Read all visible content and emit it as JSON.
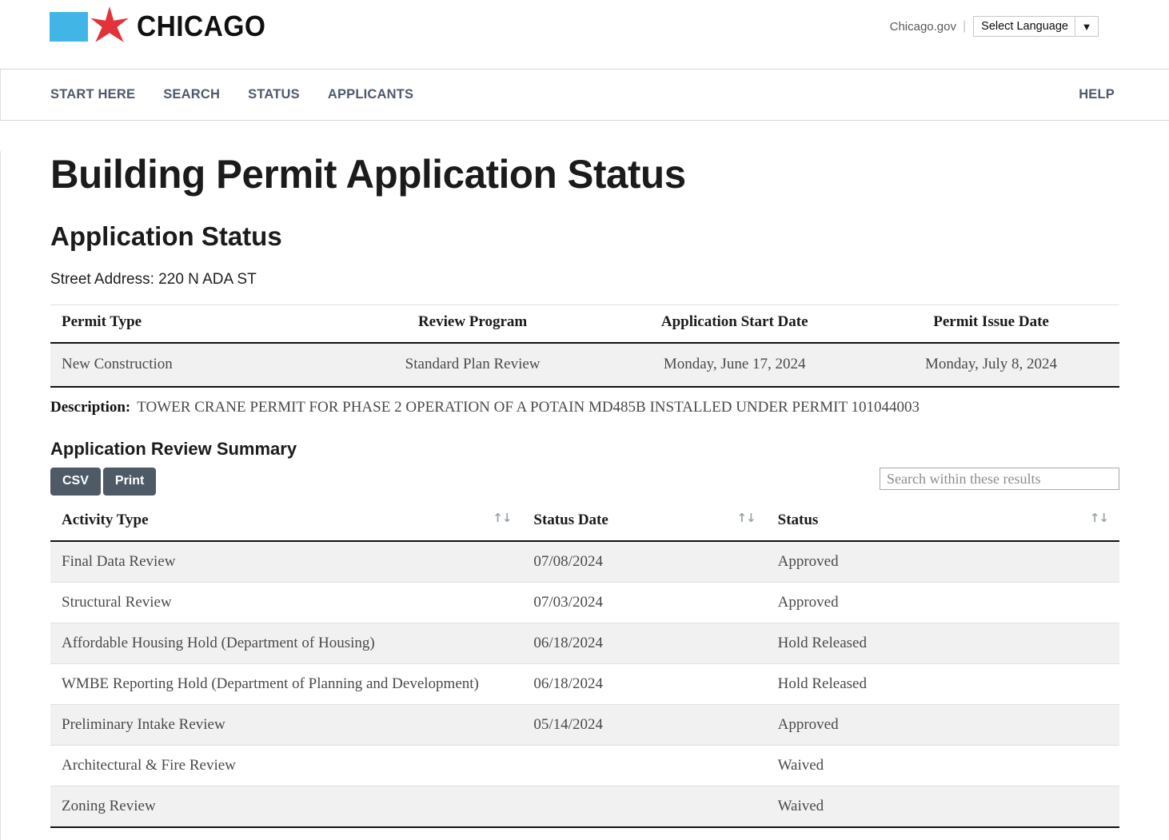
{
  "brand": {
    "logo_flag_color": "#41b6e6",
    "logo_star_color": "#e4323c",
    "wordmark": "CHICAGO",
    "gov_link": "Chicago.gov",
    "separator": "|",
    "language_label": "Select Language",
    "language_caret": "▼"
  },
  "nav": {
    "items": [
      {
        "label": "START HERE"
      },
      {
        "label": "SEARCH"
      },
      {
        "label": "STATUS"
      },
      {
        "label": "APPLICANTS"
      }
    ],
    "help_label": "HELP"
  },
  "main": {
    "page_title": "Building Permit Application Status",
    "section_title": "Application Status",
    "street_address": "Street Address: 220 N ADA ST"
  },
  "permit_table": {
    "headers": [
      "Permit Type",
      "Review Program",
      "Application Start Date",
      "Permit Issue Date"
    ],
    "row": [
      "New Construction",
      "Standard Plan Review",
      "Monday, June 17, 2024",
      "Monday, July 8, 2024"
    ]
  },
  "description": {
    "label": "Description:",
    "text": "TOWER CRANE PERMIT FOR PHASE 2 OPERATION OF A POTAIN MD485B INSTALLED UNDER PERMIT 101044003"
  },
  "summary": {
    "title": "Application Review Summary",
    "csv_label": "CSV",
    "print_label": "Print",
    "search_placeholder": "Search within these results",
    "search_value": "",
    "sort_icon": "↑↓"
  },
  "activity_table": {
    "headers": [
      "Activity Type",
      "Status Date",
      "Status"
    ],
    "rows": [
      {
        "activity": "Final Data Review",
        "date": "07/08/2024",
        "status": "Approved"
      },
      {
        "activity": "Structural Review",
        "date": "07/03/2024",
        "status": "Approved"
      },
      {
        "activity": "Affordable Housing Hold (Department of Housing)",
        "date": "06/18/2024",
        "status": "Hold Released"
      },
      {
        "activity": "WMBE Reporting Hold (Department of Planning and Development)",
        "date": "06/18/2024",
        "status": "Hold Released"
      },
      {
        "activity": "Preliminary Intake Review",
        "date": "05/14/2024",
        "status": "Approved"
      },
      {
        "activity": "Architectural & Fire Review",
        "date": "",
        "status": "Waived"
      },
      {
        "activity": "Zoning Review",
        "date": "",
        "status": "Waived"
      }
    ]
  },
  "colors": {
    "nav_text": "#4e5a6b",
    "button_bg": "#4e5a66",
    "row_alt_bg": "#f1f1f1",
    "brand_blue": "#41b6e6",
    "brand_red": "#e4323c"
  }
}
